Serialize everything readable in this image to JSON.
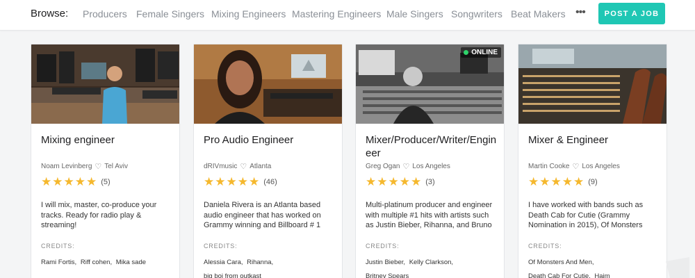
{
  "browse": {
    "label": "Browse:",
    "links": [
      "Producers",
      "Female Singers",
      "Mixing Engineers",
      "Mastering Engineers",
      "Male Singers",
      "Songwriters",
      "Beat Makers"
    ],
    "more_icon": "more-dots-icon",
    "post_job": "POST A JOB"
  },
  "colors": {
    "accent": "#1fc7b4",
    "star": "#f5b82e",
    "online": "#2ed36a"
  },
  "cards": [
    {
      "title": "Mixing engineer",
      "name": "Noam Levinberg",
      "location": "Tel Aviv",
      "stars": 5,
      "reviews": "(5)",
      "description": "I will mix, master, co-produce your tracks. Ready for radio play & streaming!",
      "credits_label": "CREDITS:",
      "credits": [
        "Rami Fortis,",
        "Riff cohen,",
        "Mika sade"
      ],
      "online": false
    },
    {
      "title": "Pro Audio Engineer",
      "name": "dRIVmusic",
      "location": "Atlanta",
      "stars": 5,
      "reviews": "(46)",
      "description": "Daniela Rivera is an Atlanta based audio engineer that has worked on Grammy winning and Billboard # 1",
      "credits_label": "CREDITS:",
      "credits": [
        "Alessia Cara,",
        "Rihanna,",
        "big boi from outkast"
      ],
      "online": false
    },
    {
      "title": "Mixer/Producer/Writer/Engineer",
      "name": "Greg Ogan",
      "location": "Los Angeles",
      "stars": 5,
      "reviews": "(3)",
      "description": "Multi-platinum producer and engineer with multiple #1 hits with artists such as Justin Bieber, Rihanna, and Bruno",
      "credits_label": "CREDITS:",
      "credits": [
        "Justin Bieber,",
        "Kelly Clarkson,",
        "Britney Spears"
      ],
      "online": true,
      "online_label": "ONLINE"
    },
    {
      "title": "Mixer & Engineer",
      "name": "Martin Cooke",
      "location": "Los Angeles",
      "stars": 5,
      "reviews": "(9)",
      "description": "I have worked with bands such as Death Cab for Cutie (Grammy Nomination in 2015), Of Monsters",
      "credits_label": "CREDITS:",
      "credits": [
        "Of Monsters And Men,",
        "Death Cab For Cutie,",
        "Haim"
      ],
      "online": false
    }
  ]
}
